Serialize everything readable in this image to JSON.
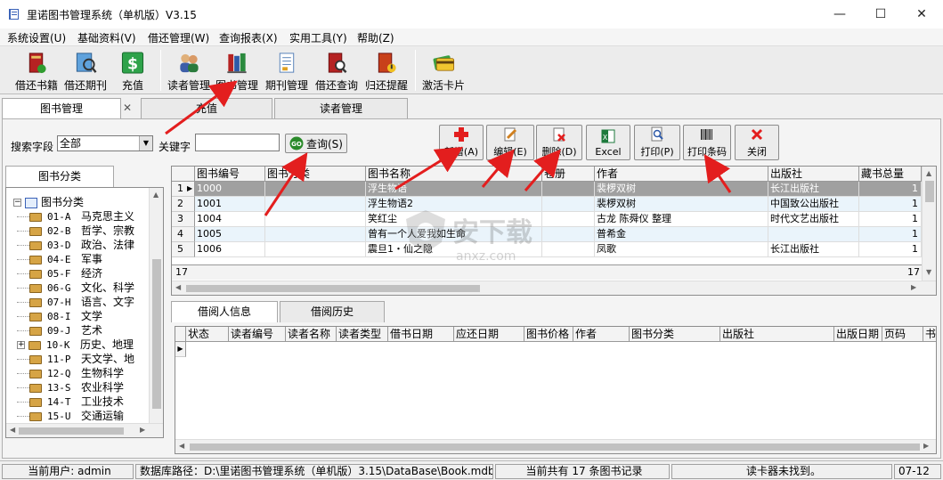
{
  "window": {
    "title": "里诺图书管理系统（单机版）V3.15",
    "min": "—",
    "max": "☐",
    "close": "✕"
  },
  "menu": [
    "系统设置(U)",
    "基础资料(V)",
    "借还管理(W)",
    "查询报表(X)",
    "实用工具(Y)",
    "帮助(Z)"
  ],
  "toolbar": [
    "借还书籍",
    "借还期刊",
    "充值",
    "读者管理",
    "图书管理",
    "期刊管理",
    "借还查询",
    "归还提醒",
    "激活卡片"
  ],
  "tabs": {
    "main": "图书管理",
    "close": "✕",
    "recharge": "充值",
    "reader": "读者管理"
  },
  "search": {
    "field_label": "搜索字段",
    "field_value": "全部",
    "keyword_label": "关键字",
    "keyword_value": "",
    "query_button": "查询(S)",
    "query_icon": "GO"
  },
  "actions": [
    "新增(A)",
    "编辑(E)",
    "删除(D)",
    "Excel",
    "打印(P)",
    "打印条码",
    "关闭"
  ],
  "tree": {
    "tab": "图书分类",
    "root": "图书分类",
    "items": [
      {
        "code": "01-A",
        "name": "马克思主义"
      },
      {
        "code": "02-B",
        "name": "哲学、宗教"
      },
      {
        "code": "03-D",
        "name": "政治、法律"
      },
      {
        "code": "04-E",
        "name": "军事"
      },
      {
        "code": "05-F",
        "name": "经济"
      },
      {
        "code": "06-G",
        "name": "文化、科学"
      },
      {
        "code": "07-H",
        "name": "语言、文字"
      },
      {
        "code": "08-I",
        "name": "文学"
      },
      {
        "code": "09-J",
        "name": "艺术"
      },
      {
        "code": "10-K",
        "name": "历史、地理"
      },
      {
        "code": "11-P",
        "name": "天文学、地"
      },
      {
        "code": "12-Q",
        "name": "生物科学"
      },
      {
        "code": "13-S",
        "name": "农业科学"
      },
      {
        "code": "14-T",
        "name": "工业技术"
      },
      {
        "code": "15-U",
        "name": "交通运输"
      },
      {
        "code": "16-V",
        "name": "航空、航天"
      }
    ]
  },
  "books": {
    "columns": [
      "图书编号",
      "图书分类",
      "图书名称",
      "卷册",
      "作者",
      "出版社",
      "藏书总量"
    ],
    "rows": [
      {
        "n": "1",
        "id": "1000",
        "cat": "",
        "name": "浮生物语",
        "vol": "",
        "author": "裴椤双树",
        "pub": "长江出版社",
        "total": "1"
      },
      {
        "n": "2",
        "id": "1001",
        "cat": "",
        "name": "浮生物语2",
        "vol": "",
        "author": "裴椤双树",
        "pub": "中国致公出版社",
        "total": "1"
      },
      {
        "n": "3",
        "id": "1004",
        "cat": "",
        "name": "笑红尘",
        "vol": "",
        "author": "古龙 陈舜仪 整理",
        "pub": "时代文艺出版社",
        "total": "1"
      },
      {
        "n": "4",
        "id": "1005",
        "cat": "",
        "name": "曾有一个人爱我如生命",
        "vol": "",
        "author": "普希金",
        "pub": "",
        "total": "1"
      },
      {
        "n": "5",
        "id": "1006",
        "cat": "",
        "name": "震旦1・仙之隐",
        "vol": "",
        "author": "凤歌",
        "pub": "长江出版社",
        "total": "1"
      }
    ],
    "footer_count": "17",
    "footer_total": "17"
  },
  "lower_tabs": [
    "借阅人信息",
    "借阅历史"
  ],
  "borrow": {
    "columns": [
      "状态",
      "读者编号",
      "读者名称",
      "读者类型",
      "借书日期",
      "应还日期",
      "图书价格",
      "作者",
      "图书分类",
      "出版社",
      "出版日期",
      "页码",
      "书"
    ]
  },
  "status": {
    "user": "当前用户: admin",
    "dbpath": "数据库路径：D:\\里诺图书管理系统（单机版）3.15\\DataBase\\Book.mdb",
    "count": "当前共有 17 条图书记录",
    "reader": "读卡器未找到。",
    "date": "07-12"
  },
  "watermark": {
    "big": "安下载",
    "small": "anxz.com"
  },
  "colors": {
    "accent_red": "#e31e1e",
    "selected_row": "#a0a0a0",
    "alt_row": "#eaf4fb"
  }
}
